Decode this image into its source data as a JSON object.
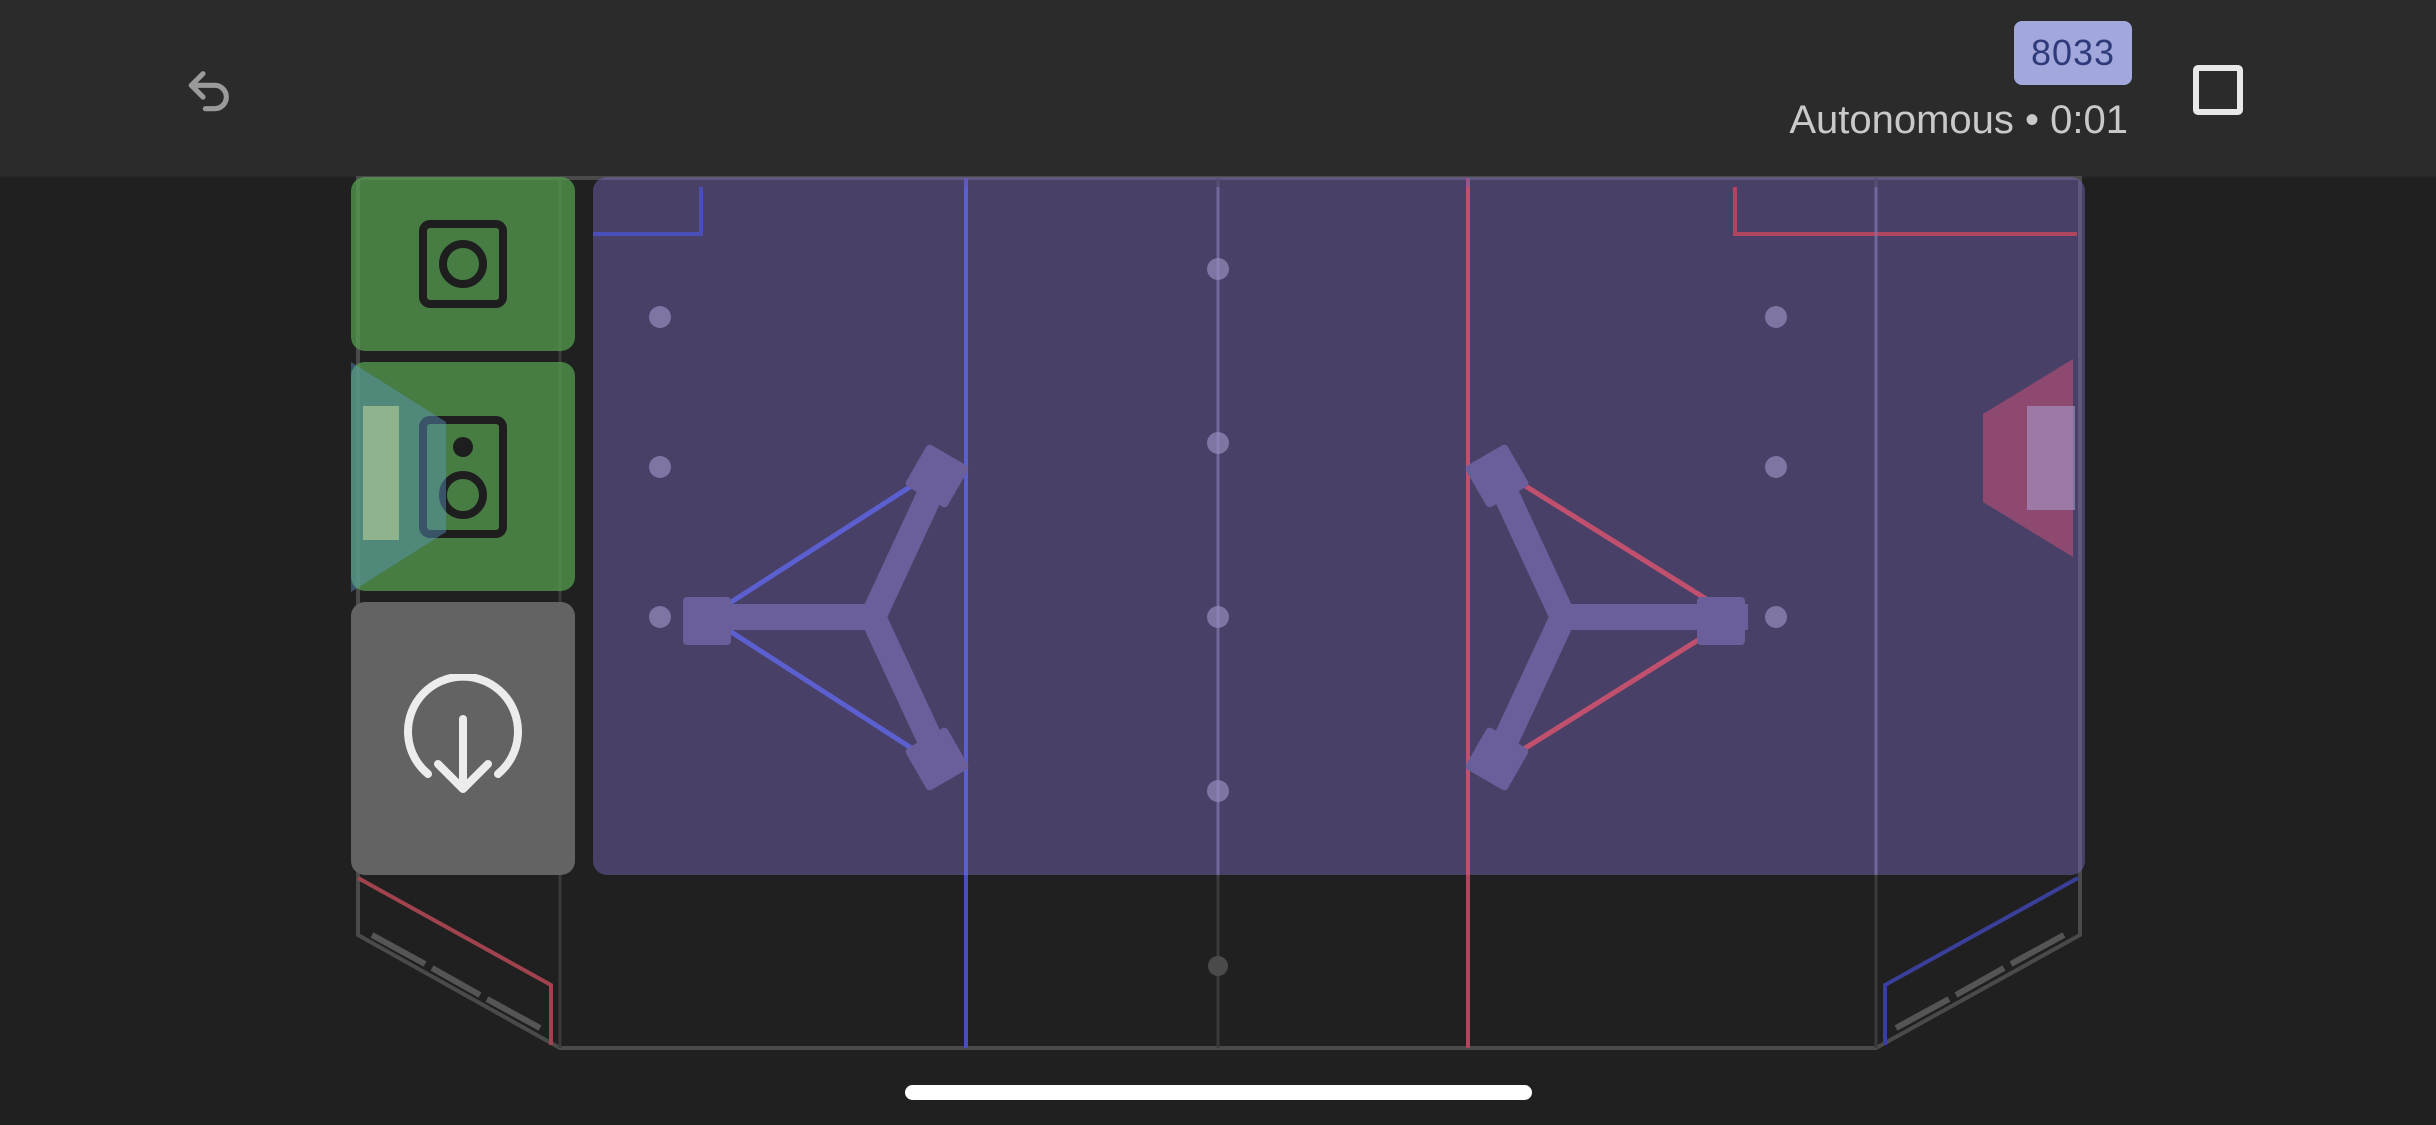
{
  "header": {
    "team_number": "8033",
    "status_text": "Autonomous • 0:01"
  },
  "icons": {
    "undo": "undo-icon",
    "stop": "stop-square-icon",
    "score_top": "speaker-one-circle-icon",
    "score_middle": "speaker-icon",
    "drop": "circle-down-arrow-icon"
  },
  "colors": {
    "team_badge_bg": "#a2a8dc",
    "team_badge_text": "#2f3a7a",
    "score_button": "#56a050",
    "drop_button": "#636363",
    "field_overlay": "#7a68be",
    "blue_alliance": "#4a4fb8",
    "red_alliance": "#b0455f"
  }
}
